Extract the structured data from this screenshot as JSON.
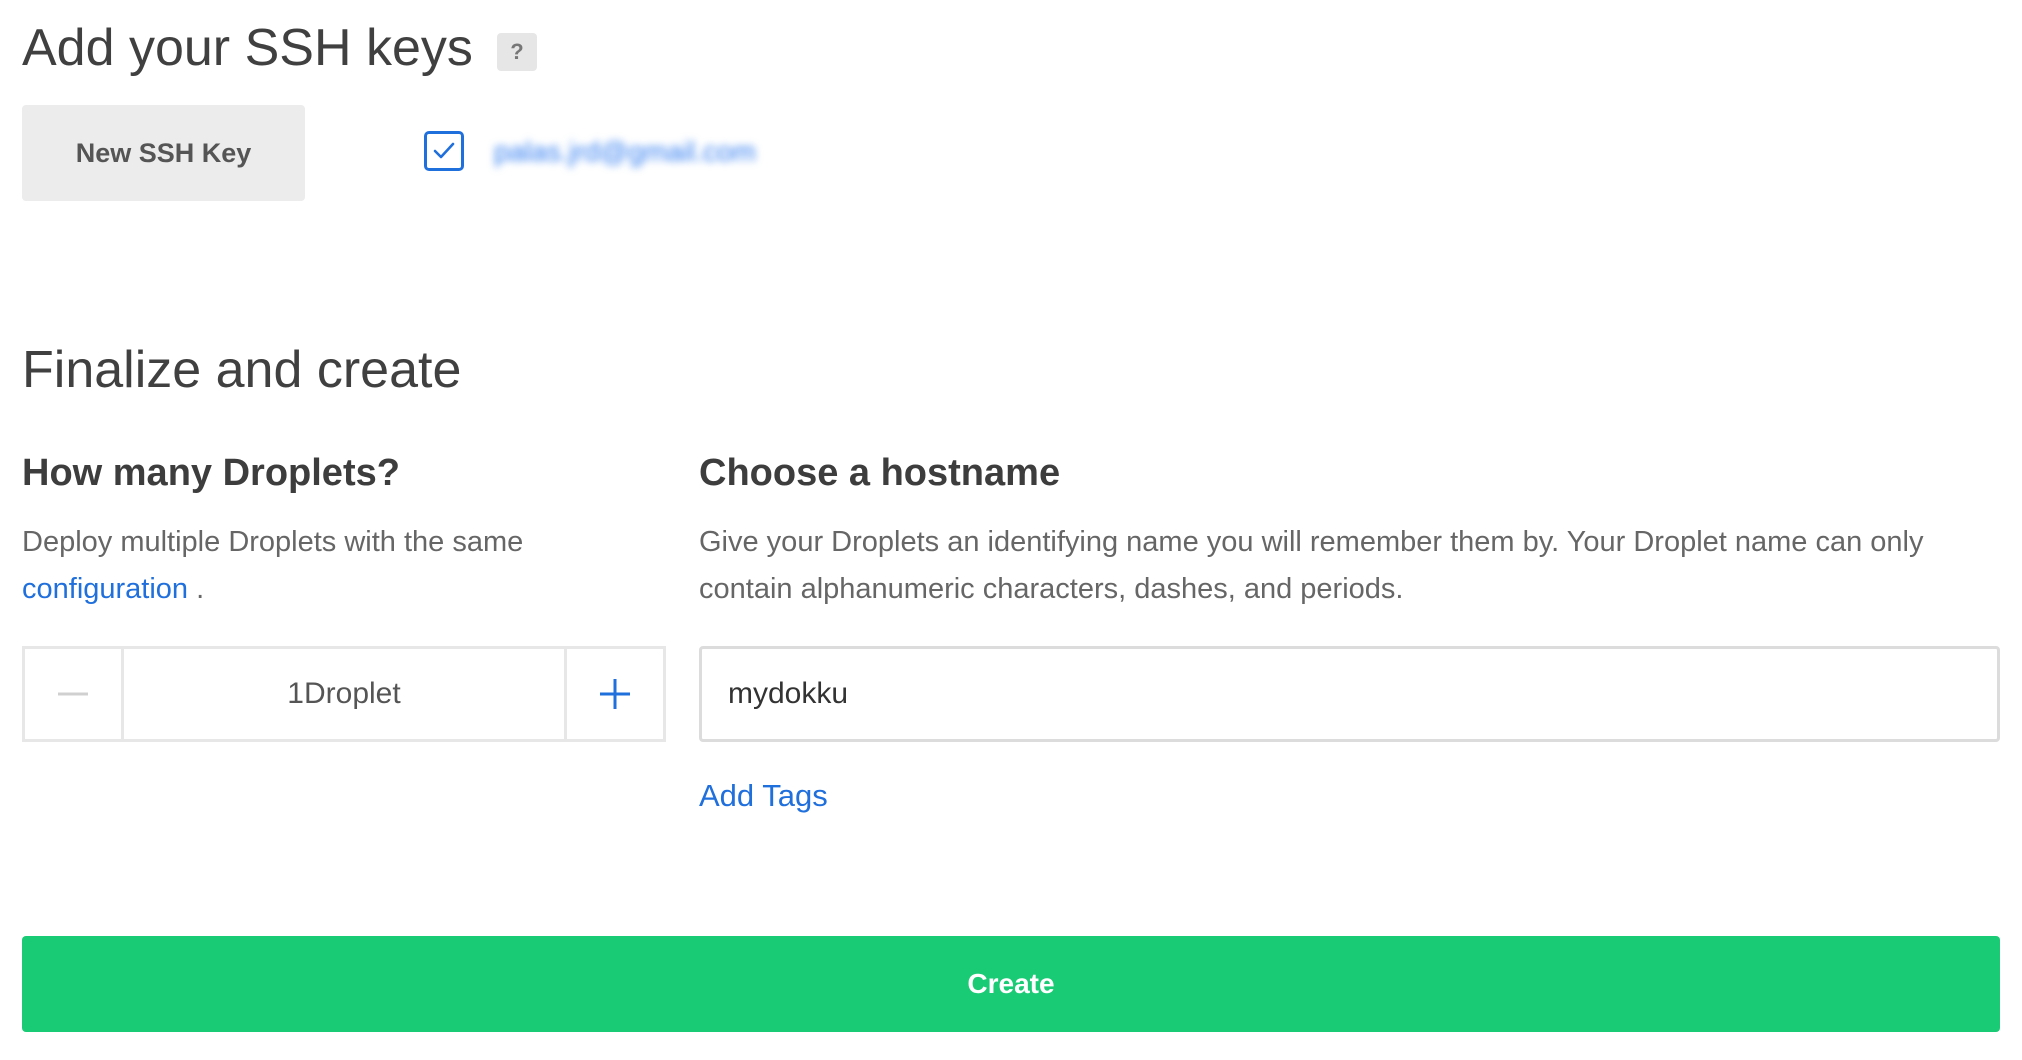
{
  "ssh_section": {
    "title": "Add your SSH keys",
    "help_badge": "?",
    "new_key_button": "New SSH Key",
    "key": {
      "checked": true,
      "label": "palas.jrd@gmail.com"
    }
  },
  "finalize": {
    "title": "Finalize and create",
    "droplets": {
      "heading": "How many Droplets?",
      "description": "Deploy multiple Droplets with the same",
      "link_text": "configuration",
      "suffix": " .",
      "count": "1",
      "unit": "Droplet"
    },
    "hostname": {
      "heading": "Choose a hostname",
      "description": "Give your Droplets an identifying name you will remember them by. Your Droplet name can only contain alphanumeric characters, dashes, and periods.",
      "value": "mydokku",
      "add_tags_link": "Add Tags"
    },
    "create_button": "Create"
  },
  "icons": {
    "checkbox": "check-icon",
    "decrement": "minus-icon",
    "increment": "plus-icon"
  },
  "colors": {
    "accent_blue": "#1f6fdc",
    "create_green": "#19cb75",
    "button_gray": "#ececec"
  }
}
